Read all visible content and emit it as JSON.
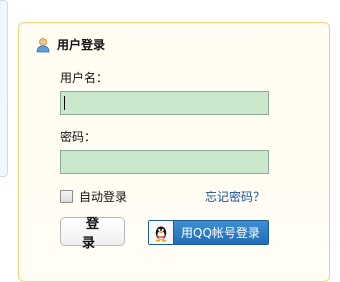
{
  "login": {
    "title": "用户登录",
    "username_label": "用户名：",
    "username_value": "",
    "password_label": "密码：",
    "password_value": "",
    "remember_label": "自动登录",
    "remember_checked": false,
    "forgot_label": "忘记密码？",
    "login_button": "登 录",
    "qq_button": "用QQ帐号登录"
  },
  "icons": {
    "header": "user-icon",
    "qq": "qq-penguin-icon"
  },
  "colors": {
    "card_border": "#f0d27a",
    "field_background": "#c9e8cc",
    "link": "#1a4f9c",
    "qq_button": "#2a7bc6"
  }
}
